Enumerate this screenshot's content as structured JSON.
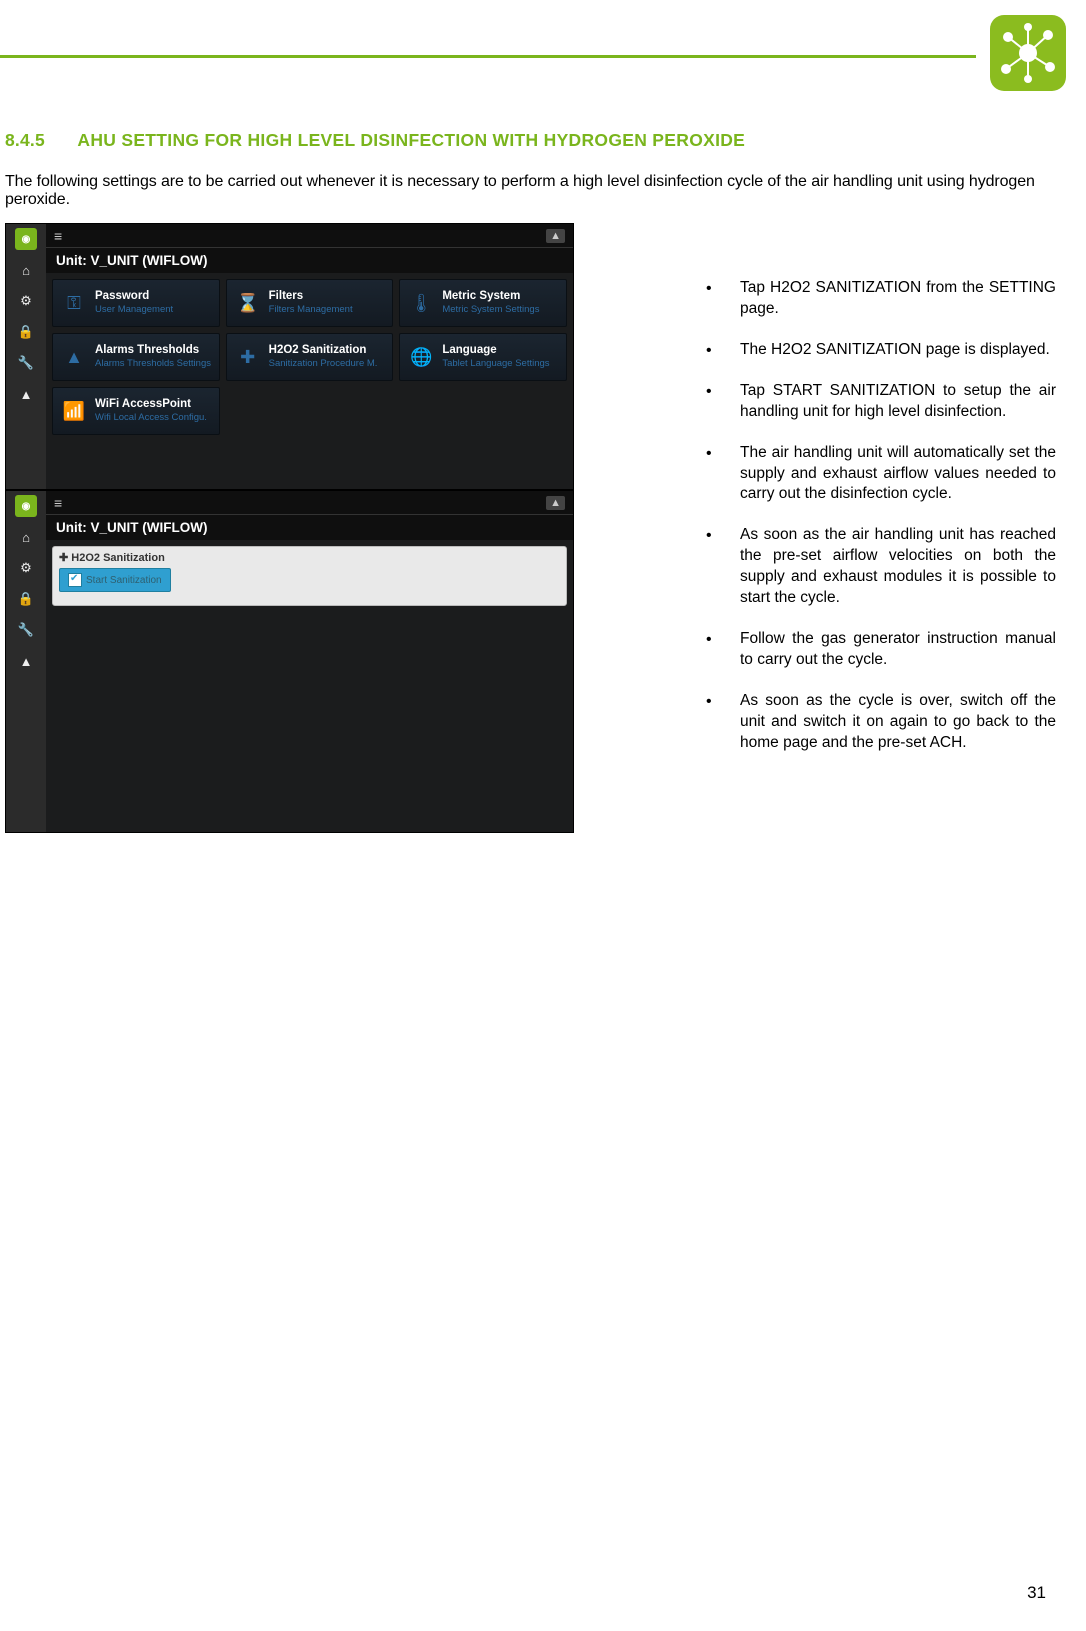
{
  "page_number": "31",
  "section": {
    "number": "8.4.5",
    "title": "AHU SETTING FOR HIGH LEVEL DISINFECTION WITH HYDROGEN PEROXIDE"
  },
  "intro": "The following settings are to be carried out whenever it is necessary to perform a high level disinfection cycle of the air handling unit using hydrogen peroxide.",
  "screen1": {
    "unit_label": "Unit: V_UNIT (WIFLOW)",
    "tiles": [
      {
        "title": "Password",
        "sub": "User Management"
      },
      {
        "title": "Filters",
        "sub": "Filters Management"
      },
      {
        "title": "Metric System",
        "sub": "Metric System Settings"
      },
      {
        "title": "Alarms Thresholds",
        "sub": "Alarms Thresholds Settings"
      },
      {
        "title": "H2O2 Sanitization",
        "sub": "Sanitization Procedure M."
      },
      {
        "title": "Language",
        "sub": "Tablet Language Settings"
      },
      {
        "title": "WiFi AccessPoint",
        "sub": "Wifi Local Access Configu."
      }
    ]
  },
  "screen2": {
    "unit_label": "Unit: V_UNIT (WIFLOW)",
    "panel_title": "H2O2 Sanitization",
    "button_label": "Start Sanitization"
  },
  "bullets": [
    "Tap H2O2 SANITIZATION from the SETTING page.",
    "The H2O2 SANITIZATION page is displayed.",
    "Tap START SANITIZATION to setup the air handling unit for high level disinfection.",
    "The air handling unit will automatically set the supply and exhaust airflow values needed to carry out the disinfection cycle.",
    "As soon as the air handling unit has reached the pre-set airflow velocities on both the supply and exhaust modules it is possible to start the cycle.",
    "Follow the gas generator instruction manual to carry out the cycle.",
    "As soon as the cycle is over, switch off the unit and switch it on again to go back to the home page and the pre-set ACH."
  ]
}
